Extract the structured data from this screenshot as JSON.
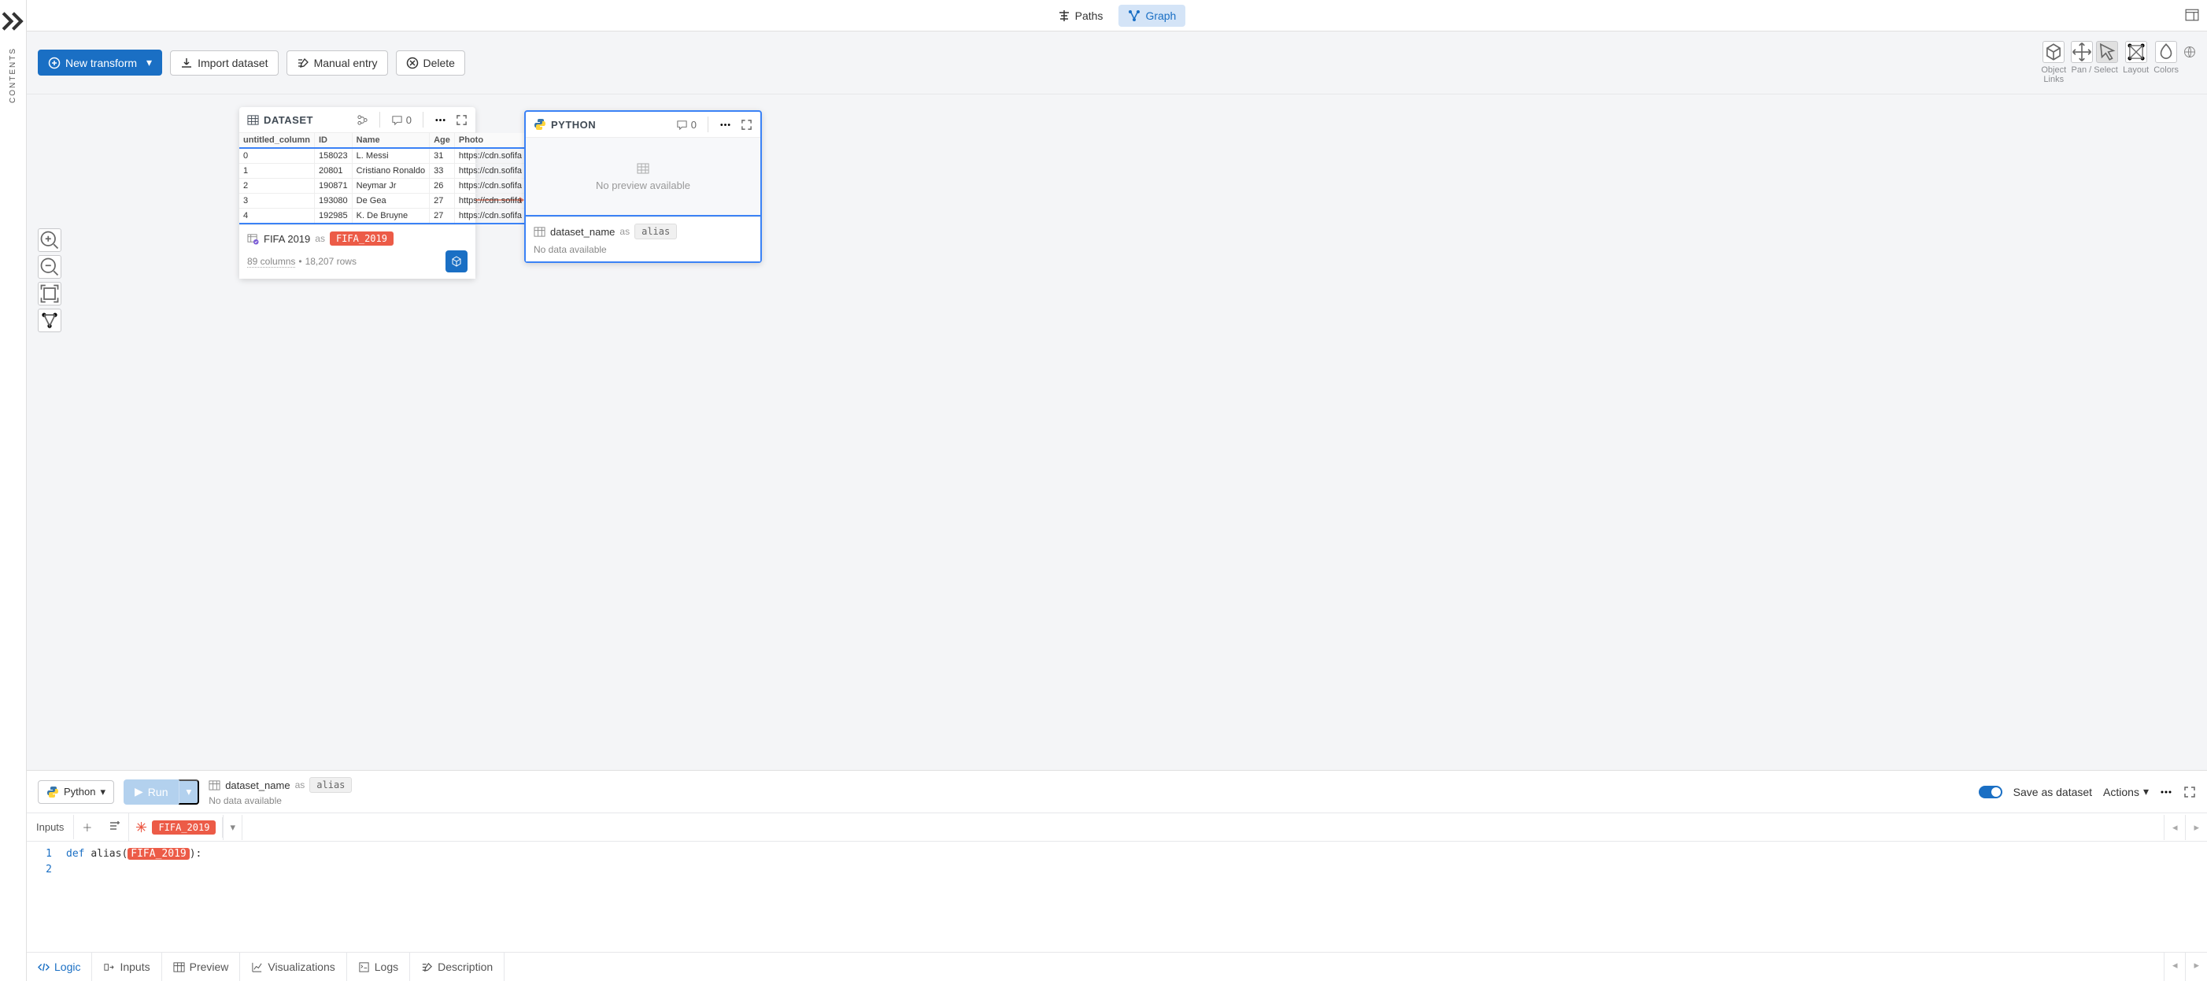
{
  "sidebar": {
    "label": "CONTENTS"
  },
  "top_tabs": {
    "paths": "Paths",
    "graph": "Graph"
  },
  "toolbar": {
    "new_transform": "New transform",
    "import_dataset": "Import dataset",
    "manual_entry": "Manual entry",
    "delete": "Delete",
    "object_links": "Object\nLinks",
    "pan_select": "Pan / Select",
    "layout": "Layout",
    "colors": "Colors"
  },
  "dataset_node": {
    "title": "DATASET",
    "comments": "0",
    "columns": [
      "untitled_column",
      "ID",
      "Name",
      "Age",
      "Photo"
    ],
    "rows": [
      [
        "0",
        "158023",
        "L. Messi",
        "31",
        "https://cdn.sofifa"
      ],
      [
        "1",
        "20801",
        "Cristiano Ronaldo",
        "33",
        "https://cdn.sofifa"
      ],
      [
        "2",
        "190871",
        "Neymar Jr",
        "26",
        "https://cdn.sofifa"
      ],
      [
        "3",
        "193080",
        "De Gea",
        "27",
        "https://cdn.sofifa"
      ],
      [
        "4",
        "192985",
        "K. De Bruyne",
        "27",
        "https://cdn.sofifa"
      ]
    ],
    "footer_name": "FIFA 2019",
    "footer_as": "as",
    "footer_alias": "FIFA_2019",
    "meta_cols": "89 columns",
    "meta_rows": "18,207 rows"
  },
  "python_node": {
    "title": "PYTHON",
    "comments": "0",
    "no_preview": "No preview available",
    "footer_name": "dataset_name",
    "footer_as": "as",
    "footer_alias": "alias",
    "no_data": "No data available"
  },
  "editor": {
    "language": "Python",
    "run": "Run",
    "ds_name": "dataset_name",
    "ds_as": "as",
    "ds_alias": "alias",
    "no_data": "No data available",
    "save_label": "Save as dataset",
    "actions": "Actions"
  },
  "inputs": {
    "label": "Inputs",
    "chip": "FIFA_2019"
  },
  "code": {
    "def": "def",
    "fn": "alias",
    "param": "FIFA_2019",
    "line1_tail": "):"
  },
  "bottom": {
    "logic": "Logic",
    "inputs": "Inputs",
    "preview": "Preview",
    "visualizations": "Visualizations",
    "logs": "Logs",
    "description": "Description"
  }
}
